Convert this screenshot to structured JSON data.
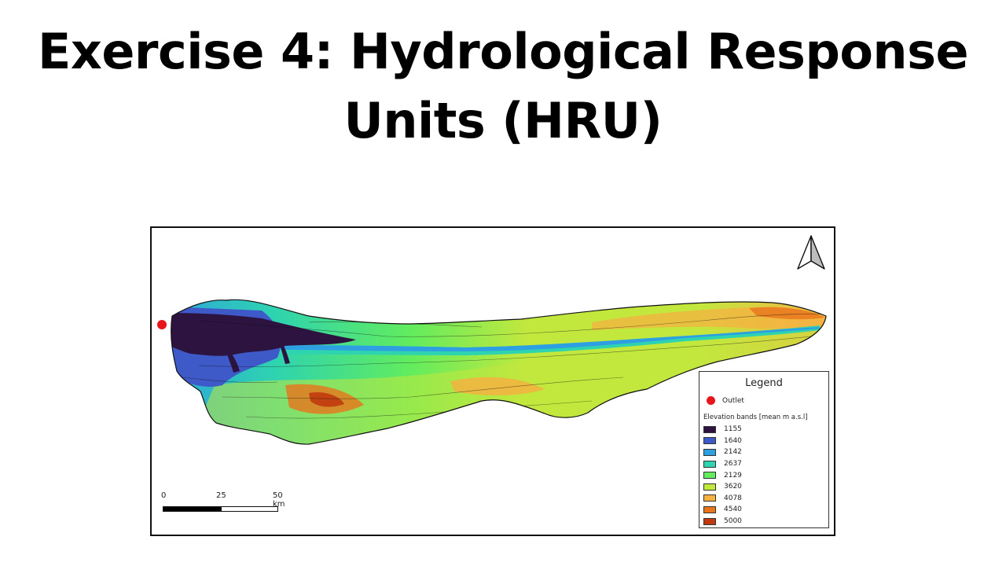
{
  "title": {
    "line1": "Exercise 4:  Hydrological Response",
    "line2": "Units (HRU)"
  },
  "map": {
    "legend": {
      "title": "Legend",
      "outlet_label": "Outlet",
      "outlet_color": "#e8161b",
      "bands_title": "Elevation bands [mean m a.s.l]",
      "bands": [
        {
          "label": "1155",
          "color": "#2c1340"
        },
        {
          "label": "1640",
          "color": "#3e5ac8"
        },
        {
          "label": "2142",
          "color": "#2e9fe0"
        },
        {
          "label": "2637",
          "color": "#2ed3b0"
        },
        {
          "label": "2129",
          "color": "#62ec5e"
        },
        {
          "label": "3620",
          "color": "#c2e83e"
        },
        {
          "label": "4078",
          "color": "#f5b241"
        },
        {
          "label": "4540",
          "color": "#e8741c"
        },
        {
          "label": "5000",
          "color": "#c03a10"
        }
      ]
    },
    "scale_bar": {
      "labels": [
        "0",
        "25",
        "50 km"
      ]
    },
    "north_arrow_icon": "north-arrow-icon"
  }
}
